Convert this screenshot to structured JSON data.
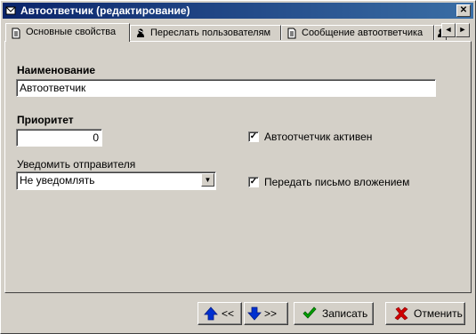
{
  "window": {
    "title": "Автоответчик (редактирование)",
    "close_glyph": "✕"
  },
  "tabs": [
    {
      "label": "Основные свойства",
      "icon": "document-icon",
      "active": true
    },
    {
      "label": "Переслать пользователям",
      "icon": "forward-user-icon"
    },
    {
      "label": "Сообщение автоответчика",
      "icon": "document-icon"
    }
  ],
  "tab_scroll": {
    "left": "◄",
    "right": "►"
  },
  "form": {
    "name_label": "Наименование",
    "name_value": "Автоответчик",
    "priority_label": "Приоритет",
    "priority_value": "0",
    "notify_label": "Уведомить отправителя",
    "notify_value": "Не уведомлять",
    "dropdown_glyph": "▼",
    "active_checkbox_label": "Автоотчетчик активен",
    "active_checked": true,
    "attach_checkbox_label": "Передать письмо вложением",
    "attach_checked": true,
    "check_glyph": "✓"
  },
  "buttons": {
    "prev_label": "<<",
    "next_label": ">>",
    "save_label": "Записать",
    "cancel_label": "Отменить"
  },
  "colors": {
    "title_bg": "#0a246a",
    "arrow_blue": "#0030d0",
    "save_green": "#008000",
    "cancel_red": "#d00000"
  }
}
